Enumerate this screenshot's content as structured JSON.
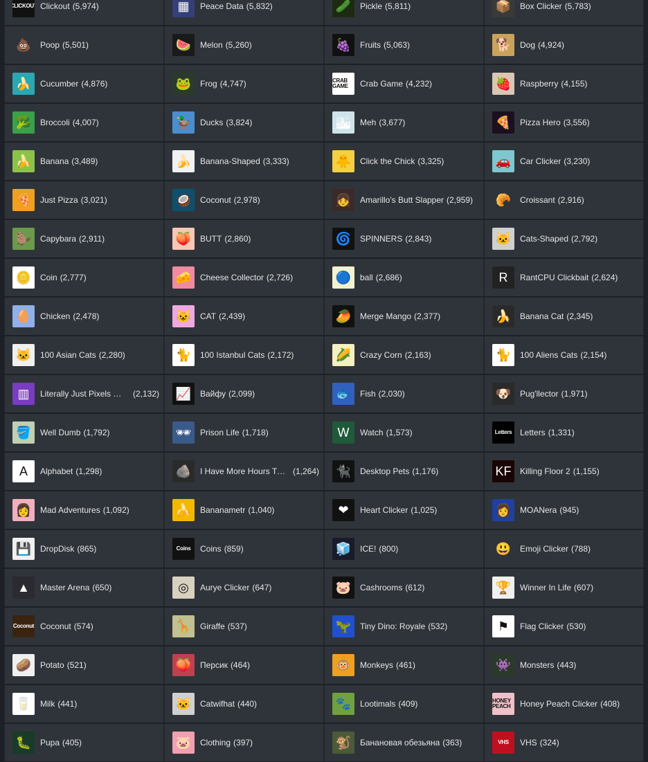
{
  "items": [
    [
      {
        "name": "Clickout",
        "count": "(5,974)",
        "icon": "clickout-logo-icon",
        "bg": "#111111",
        "glyph": "CLICKOUT",
        "small": true
      },
      {
        "name": "Peace Data",
        "count": "(5,832)",
        "icon": "peace-grid-icon",
        "bg": "#35407a",
        "glyph": "▦"
      },
      {
        "name": "Pickle",
        "count": "(5,811)",
        "icon": "pickle-icon",
        "bg": "#1d2a12",
        "glyph": "🥒"
      },
      {
        "name": "Box Clicker",
        "count": "(5,783)",
        "icon": "box-icon",
        "bg": "#3a3a3a",
        "glyph": "📦"
      }
    ],
    [
      {
        "name": "Poop",
        "count": "(5,501)",
        "icon": "poop-icon",
        "bg": "#2f343a",
        "glyph": "💩"
      },
      {
        "name": "Melon",
        "count": "(5,260)",
        "icon": "watermelon-icon",
        "bg": "#1a1a1a",
        "glyph": "🍉"
      },
      {
        "name": "Fruits",
        "count": "(5,063)",
        "icon": "fruits-icon",
        "bg": "#111111",
        "glyph": "🍇"
      },
      {
        "name": "Dog",
        "count": "(4,924)",
        "icon": "doge-icon",
        "bg": "#c9a35a",
        "glyph": "🐕"
      }
    ],
    [
      {
        "name": "Cucumber",
        "count": "(4,876)",
        "icon": "banana-cucumber-icon",
        "bg": "#2aa7b3",
        "glyph": "🍌"
      },
      {
        "name": "Frog",
        "count": "(4,747)",
        "icon": "frog-icon",
        "bg": "#2b3a2b",
        "glyph": "🐸"
      },
      {
        "name": "Crab Game",
        "count": "(4,232)",
        "icon": "crab-game-logo-icon",
        "bg": "#ffffff",
        "glyph": "CRAB GAME",
        "small": true,
        "dark": true
      },
      {
        "name": "Raspberry",
        "count": "(4,155)",
        "icon": "raspberry-icon",
        "bg": "#d9c7b4",
        "glyph": "🍓"
      }
    ],
    [
      {
        "name": "Broccoli",
        "count": "(4,007)",
        "icon": "broccoli-icon",
        "bg": "#3aa04a",
        "glyph": "🥦"
      },
      {
        "name": "Ducks",
        "count": "(3,824)",
        "icon": "duck-icon",
        "bg": "#4a8ed0",
        "glyph": "🦆"
      },
      {
        "name": "Meh",
        "count": "(3,677)",
        "icon": "meh-icon",
        "bg": "#cfe4ea",
        "glyph": "🏙"
      },
      {
        "name": "Pizza Hero",
        "count": "(3,556)",
        "icon": "pizza-hero-icon",
        "bg": "#1a1020",
        "glyph": "🍕"
      }
    ],
    [
      {
        "name": "Banana",
        "count": "(3,489)",
        "icon": "banana-logo-icon",
        "bg": "#8bc34a",
        "glyph": "🍌"
      },
      {
        "name": "Banana-Shaped",
        "count": "(3,333)",
        "icon": "banana-shaped-icon",
        "bg": "#f2f2f2",
        "glyph": "🍌"
      },
      {
        "name": "Click the Chick",
        "count": "(3,325)",
        "icon": "chick-icon",
        "bg": "#f5cf43",
        "glyph": "🐥"
      },
      {
        "name": "Car Clicker",
        "count": "(3,230)",
        "icon": "car-icon",
        "bg": "#7ec7d0",
        "glyph": "🚗"
      }
    ],
    [
      {
        "name": "Just Pizza",
        "count": "(3,021)",
        "icon": "pizza-icon",
        "bg": "#f0a020",
        "glyph": "🍕"
      },
      {
        "name": "Coconut",
        "count": "(2,978)",
        "icon": "coconut-icon",
        "bg": "#0e4f6e",
        "glyph": "🥥"
      },
      {
        "name": "Amarillo's Butt Slapper",
        "count": "(2,959)",
        "icon": "anime-girl-icon",
        "bg": "#3b2a2a",
        "glyph": "👧"
      },
      {
        "name": "Croissant",
        "count": "(2,916)",
        "icon": "croissant-icon",
        "bg": "#2f343a",
        "glyph": "🥐"
      }
    ],
    [
      {
        "name": "Capybara",
        "count": "(2,911)",
        "icon": "capybara-icon",
        "bg": "#6a9a4a",
        "glyph": "🦫"
      },
      {
        "name": "BUTT",
        "count": "(2,860)",
        "icon": "peach-butt-icon",
        "bg": "#f7c7b5",
        "glyph": "🍑"
      },
      {
        "name": "SPINNERS",
        "count": "(2,843)",
        "icon": "spinner-icon",
        "bg": "#111111",
        "glyph": "🌀"
      },
      {
        "name": "Cats-Shaped",
        "count": "(2,792)",
        "icon": "cat-gentleman-icon",
        "bg": "#d0d0d0",
        "glyph": "🐱"
      }
    ],
    [
      {
        "name": "Coin",
        "count": "(2,777)",
        "icon": "doge-coin-icon",
        "bg": "#ffffff",
        "glyph": "🪙"
      },
      {
        "name": "Cheese Collector",
        "count": "(2,726)",
        "icon": "cheese-icon",
        "bg": "#f08aa0",
        "glyph": "🧀"
      },
      {
        "name": "ball",
        "count": "(2,686)",
        "icon": "ball-icon",
        "bg": "#f2f2d0",
        "glyph": "🔵"
      },
      {
        "name": "RantCPU Clickbait",
        "count": "(2,624)",
        "icon": "rantcpu-icon",
        "bg": "#222222",
        "glyph": "R"
      }
    ],
    [
      {
        "name": "Chicken",
        "count": "(2,478)",
        "icon": "chicken-icon",
        "bg": "#8fb0e8",
        "glyph": "🥚"
      },
      {
        "name": "CAT",
        "count": "(2,439)",
        "icon": "cat-icon",
        "bg": "#f0a8e0",
        "glyph": "😺"
      },
      {
        "name": "Merge Mango",
        "count": "(2,377)",
        "icon": "mango-icon",
        "bg": "#111111",
        "glyph": "🥭"
      },
      {
        "name": "Banana Cat",
        "count": "(2,345)",
        "icon": "banana-cat-icon",
        "bg": "#2a2a2a",
        "glyph": "🍌"
      }
    ],
    [
      {
        "name": "100 Asian Cats",
        "count": "(2,280)",
        "icon": "asian-cat-icon",
        "bg": "#f0f0f0",
        "glyph": "🐱"
      },
      {
        "name": "100 Istanbul Cats",
        "count": "(2,172)",
        "icon": "istanbul-cat-icon",
        "bg": "#ffffff",
        "glyph": "🐈"
      },
      {
        "name": "Crazy Corn",
        "count": "(2,163)",
        "icon": "corn-icon",
        "bg": "#f5f0c0",
        "glyph": "🌽"
      },
      {
        "name": "100 Aliens Cats",
        "count": "(2,154)",
        "icon": "alien-cat-icon",
        "bg": "#ffffff",
        "glyph": "🐈"
      }
    ],
    [
      {
        "name": "Literally Just Pixels On...",
        "count": "(2,132)",
        "icon": "pixels-icon",
        "bg": "#7a3cc0",
        "glyph": "▥",
        "trunc": true
      },
      {
        "name": "Вайфу",
        "count": "(2,099)",
        "icon": "chart-up-icon",
        "bg": "#111111",
        "glyph": "📈"
      },
      {
        "name": "Fish",
        "count": "(2,030)",
        "icon": "fish-icon",
        "bg": "#3060c0",
        "glyph": "🐟"
      },
      {
        "name": "Pug'llector",
        "count": "(1,971)",
        "icon": "pug-icon",
        "bg": "#2a2a2a",
        "glyph": "🐶"
      }
    ],
    [
      {
        "name": "Well Dumb",
        "count": "(1,792)",
        "icon": "bucket-icon",
        "bg": "#c0d0b0",
        "glyph": "🪣"
      },
      {
        "name": "Prison Life",
        "count": "(1,718)",
        "icon": "prisoner-icon",
        "bg": "#3a5a8a",
        "glyph": "🕶"
      },
      {
        "name": "Watch",
        "count": "(1,573)",
        "icon": "watch-w-logo-icon",
        "bg": "#1f5a3a",
        "glyph": "W"
      },
      {
        "name": "Letters",
        "count": "(1,331)",
        "icon": "letters-logo-icon",
        "bg": "#000000",
        "glyph": "Letters",
        "small": true
      }
    ],
    [
      {
        "name": "Alphabet",
        "count": "(1,298)",
        "icon": "alphabet-a-icon",
        "bg": "#ffffff",
        "glyph": "A",
        "dark": true
      },
      {
        "name": "I Have More Hours Th...",
        "count": "(1,264)",
        "icon": "rock-face-icon",
        "bg": "#2a2a2a",
        "glyph": "🪨",
        "trunc": true
      },
      {
        "name": "Desktop Pets",
        "count": "(1,176)",
        "icon": "black-cat-icon",
        "bg": "#111111",
        "glyph": "🐈‍⬛"
      },
      {
        "name": "Killing Floor 2",
        "count": "(1,155)",
        "icon": "kf2-logo-icon",
        "bg": "#1a0505",
        "glyph": "KF"
      }
    ],
    [
      {
        "name": "Mad Adventures",
        "count": "(1,092)",
        "icon": "anime-pink-icon",
        "bg": "#f0b0c0",
        "glyph": "👩"
      },
      {
        "name": "Bananametr",
        "count": "(1,040)",
        "icon": "banana-yellow-icon",
        "bg": "#f5b800",
        "glyph": "🍌"
      },
      {
        "name": "Heart Clicker",
        "count": "(1,025)",
        "icon": "heart-icon",
        "bg": "#111111",
        "glyph": "❤"
      },
      {
        "name": "MOANera",
        "count": "(945)",
        "icon": "anime-blue-icon",
        "bg": "#2040a0",
        "glyph": "👩"
      }
    ],
    [
      {
        "name": "DropDisk",
        "count": "(865)",
        "icon": "floppy-disk-icon",
        "bg": "#f0f0f0",
        "glyph": "💾"
      },
      {
        "name": "Coins",
        "count": "(859)",
        "icon": "coins-logo-icon",
        "bg": "#111111",
        "glyph": "Coins",
        "small": true
      },
      {
        "name": "ICE!",
        "count": "(800)",
        "icon": "ice-icon",
        "bg": "#1a1a2a",
        "glyph": "🧊"
      },
      {
        "name": "Emoji Clicker",
        "count": "(788)",
        "icon": "emoji-icon",
        "bg": "#2f343a",
        "glyph": "😃"
      }
    ],
    [
      {
        "name": "Master Arena",
        "count": "(650)",
        "icon": "arena-logo-icon",
        "bg": "#2a2a30",
        "glyph": "▲"
      },
      {
        "name": "Aurye Clicker",
        "count": "(647)",
        "icon": "aurye-icon",
        "bg": "#d8d0c0",
        "glyph": "◎",
        "dark": true
      },
      {
        "name": "Cashrooms",
        "count": "(612)",
        "icon": "piggy-bank-icon",
        "bg": "#111111",
        "glyph": "🐷"
      },
      {
        "name": "Winner In Life",
        "count": "(607)",
        "icon": "winner-icon",
        "bg": "#f0f0f0",
        "glyph": "🏆"
      }
    ],
    [
      {
        "name": "Coconut",
        "count": "(574)",
        "icon": "coconut-logo-icon",
        "bg": "#3a2410",
        "glyph": "Coconut",
        "small": true
      },
      {
        "name": "Giraffe",
        "count": "(537)",
        "icon": "giraffe-icon",
        "bg": "#c0c090",
        "glyph": "🦒"
      },
      {
        "name": "Tiny Dino: Royale",
        "count": "(532)",
        "icon": "dino-icon",
        "bg": "#2050d0",
        "glyph": "🦖"
      },
      {
        "name": "Flag Clicker",
        "count": "(530)",
        "icon": "flag-icon",
        "bg": "#ffffff",
        "glyph": "⚑",
        "dark": true
      }
    ],
    [
      {
        "name": "Potato",
        "count": "(521)",
        "icon": "potato-icon",
        "bg": "#f0f0f0",
        "glyph": "🥔"
      },
      {
        "name": "Персик",
        "count": "(464)",
        "icon": "peach-gradient-icon",
        "bg": "#c04050",
        "glyph": "🍑"
      },
      {
        "name": "Monkeys",
        "count": "(461)",
        "icon": "monkey-icon",
        "bg": "#f0a020",
        "glyph": "🐵"
      },
      {
        "name": "Monsters",
        "count": "(443)",
        "icon": "monster-icon",
        "bg": "#2a3a2a",
        "glyph": "👾"
      }
    ],
    [
      {
        "name": "Milk",
        "count": "(441)",
        "icon": "milk-icon",
        "bg": "#ffffff",
        "glyph": "🥛"
      },
      {
        "name": "Catwifhat",
        "count": "(440)",
        "icon": "cat-hat-icon",
        "bg": "#d0d0d0",
        "glyph": "🐱"
      },
      {
        "name": "Lootimals",
        "count": "(409)",
        "icon": "lootimals-icon",
        "bg": "#70a040",
        "glyph": "🐾"
      },
      {
        "name": "Honey Peach Clicker",
        "count": "(408)",
        "icon": "honey-peach-icon",
        "bg": "#f0c0c8",
        "glyph": "HONEY PEACH",
        "small": true,
        "dark": true
      }
    ],
    [
      {
        "name": "Pupa",
        "count": "(405)",
        "icon": "pupa-icon",
        "bg": "#1a3a2a",
        "glyph": "🐛"
      },
      {
        "name": "Clothing",
        "count": "(397)",
        "icon": "pig-icon",
        "bg": "#f0a0b0",
        "glyph": "🐷"
      },
      {
        "name": "Банановая обезьяна",
        "count": "(363)",
        "icon": "banana-monkey-icon",
        "bg": "#4a5a3a",
        "glyph": "🐒"
      },
      {
        "name": "VHS",
        "count": "(324)",
        "icon": "vhs-icon",
        "bg": "#c01020",
        "glyph": "VHS",
        "small": true
      }
    ]
  ]
}
